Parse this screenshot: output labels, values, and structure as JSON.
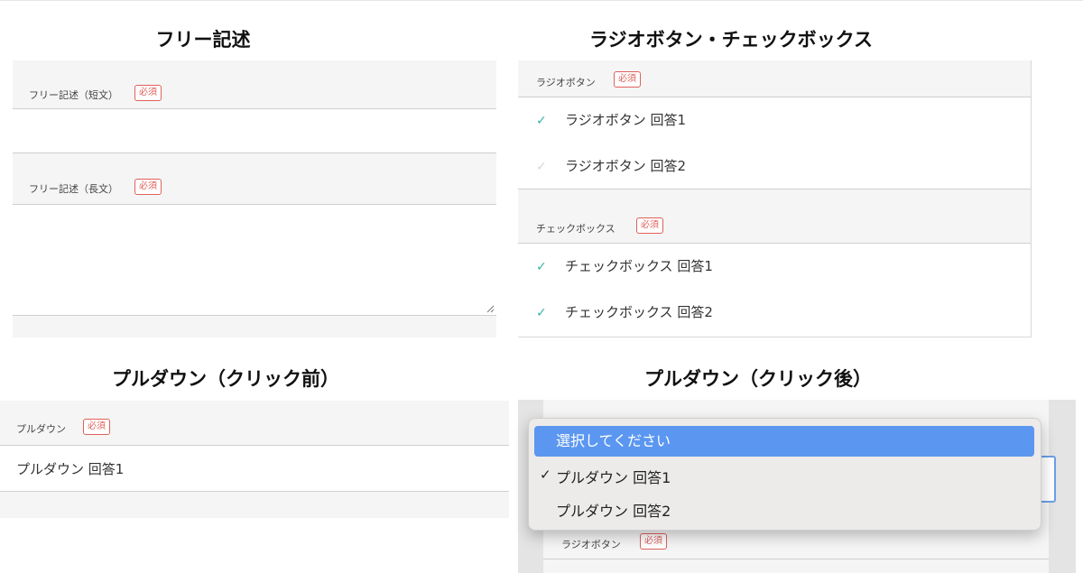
{
  "headings": {
    "free": "フリー記述",
    "radio_check": "ラジオボタン・チェックボックス",
    "pulldown_before": "プルダウン（クリック前）",
    "pulldown_after": "プルダウン（クリック後）"
  },
  "required_badge": "必須",
  "free_text": {
    "short_label": "フリー記述（短文）",
    "long_label": "フリー記述（長文）"
  },
  "radio": {
    "label": "ラジオボタン",
    "options": [
      {
        "label": "ラジオボタン 回答1",
        "checked": true
      },
      {
        "label": "ラジオボタン 回答2",
        "checked": false
      }
    ]
  },
  "checkbox": {
    "label": "チェックボックス",
    "options": [
      {
        "label": "チェックボックス 回答1",
        "checked": true
      },
      {
        "label": "チェックボックス 回答2",
        "checked": true
      }
    ]
  },
  "pulldown_before": {
    "label": "プルダウン",
    "value": "プルダウン 回答1"
  },
  "pulldown_after": {
    "menu_items": [
      {
        "label": "選択してください",
        "highlighted": true,
        "checked": false
      },
      {
        "label": "プルダウン 回答1",
        "highlighted": false,
        "checked": true
      },
      {
        "label": "プルダウン 回答2",
        "highlighted": false,
        "checked": false
      }
    ],
    "below_label": "ラジオボタン"
  },
  "glyphs": {
    "check": "✓"
  },
  "colors": {
    "required": "#e0605a",
    "check_on": "#39b3a8",
    "check_off": "#d7d7d7",
    "menu_highlight": "#5b97f0",
    "focus_border": "#6aa0e6"
  }
}
